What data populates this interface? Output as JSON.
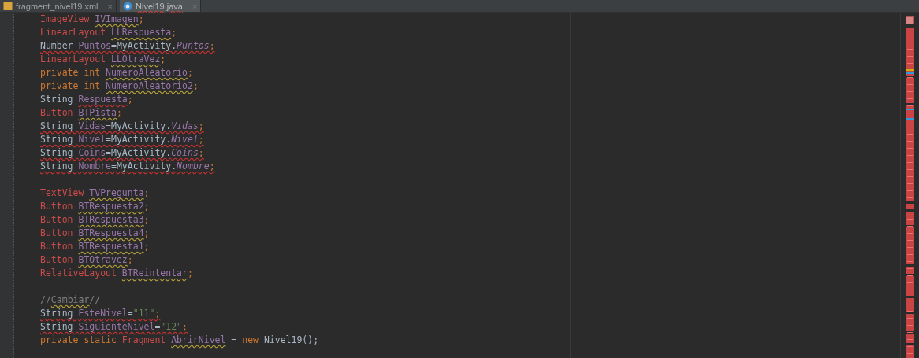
{
  "tabs": [
    {
      "label": "fragment_nivel19.xml",
      "close": "×",
      "kind": "xml",
      "selected": false
    },
    {
      "label": "Nivel19.java",
      "close": "×",
      "kind": "java",
      "selected": true
    }
  ],
  "code": [
    {
      "gap_before": false,
      "tokens": [
        {
          "text": "ImageView ",
          "kind": "type",
          "warning": false,
          "error": false
        },
        {
          "text": "IVImagen",
          "kind": "field",
          "warning": true,
          "error": false
        },
        {
          "text": ";",
          "kind": "punct",
          "warning": false,
          "error": false
        }
      ]
    },
    {
      "gap_before": false,
      "tokens": [
        {
          "text": "LinearLayout ",
          "kind": "type",
          "warning": false,
          "error": false
        },
        {
          "text": "LLRespuesta",
          "kind": "field",
          "warning": true,
          "error": false
        },
        {
          "text": ";",
          "kind": "punct",
          "warning": false,
          "error": false
        }
      ]
    },
    {
      "gap_before": false,
      "tokens": [
        {
          "text": "Number ",
          "kind": "plain",
          "warning": false,
          "error": true
        },
        {
          "text": "Puntos",
          "kind": "field",
          "warning": false,
          "error": true
        },
        {
          "text": "=MyActivity.",
          "kind": "plain",
          "warning": false,
          "error": true
        },
        {
          "text": "Puntos",
          "kind": "static",
          "warning": false,
          "error": true
        },
        {
          "text": ";",
          "kind": "punct",
          "warning": false,
          "error": true
        }
      ]
    },
    {
      "gap_before": false,
      "tokens": [
        {
          "text": "LinearLayout ",
          "kind": "type",
          "warning": false,
          "error": false
        },
        {
          "text": "LLOtraVez",
          "kind": "field",
          "warning": true,
          "error": false
        },
        {
          "text": ";",
          "kind": "punct",
          "warning": false,
          "error": false
        }
      ]
    },
    {
      "gap_before": false,
      "tokens": [
        {
          "text": "private int ",
          "kind": "keyword",
          "warning": false,
          "error": false
        },
        {
          "text": "NumeroAleatorio",
          "kind": "field",
          "warning": true,
          "error": false
        },
        {
          "text": ";",
          "kind": "punct",
          "warning": false,
          "error": false
        }
      ]
    },
    {
      "gap_before": false,
      "tokens": [
        {
          "text": "private int ",
          "kind": "keyword",
          "warning": false,
          "error": false
        },
        {
          "text": "NumeroAleatorio2",
          "kind": "field",
          "warning": true,
          "error": false
        },
        {
          "text": ";",
          "kind": "punct",
          "warning": false,
          "error": false
        }
      ]
    },
    {
      "gap_before": false,
      "tokens": [
        {
          "text": "String ",
          "kind": "plain",
          "warning": false,
          "error": false
        },
        {
          "text": "Respuesta",
          "kind": "field",
          "warning": false,
          "error": true
        },
        {
          "text": ";",
          "kind": "punct",
          "warning": false,
          "error": false
        }
      ]
    },
    {
      "gap_before": false,
      "tokens": [
        {
          "text": "Button ",
          "kind": "type",
          "warning": false,
          "error": false
        },
        {
          "text": "BTPista",
          "kind": "field",
          "warning": true,
          "error": false
        },
        {
          "text": ";",
          "kind": "punct",
          "warning": false,
          "error": false
        }
      ]
    },
    {
      "gap_before": false,
      "tokens": [
        {
          "text": "String ",
          "kind": "plain",
          "warning": false,
          "error": true
        },
        {
          "text": "Vidas",
          "kind": "field",
          "warning": false,
          "error": true
        },
        {
          "text": "=MyActivity.",
          "kind": "plain",
          "warning": false,
          "error": true
        },
        {
          "text": "Vidas",
          "kind": "static",
          "warning": false,
          "error": true
        },
        {
          "text": ";",
          "kind": "punct",
          "warning": false,
          "error": true
        }
      ]
    },
    {
      "gap_before": false,
      "tokens": [
        {
          "text": "String ",
          "kind": "plain",
          "warning": false,
          "error": true
        },
        {
          "text": "Nivel",
          "kind": "field",
          "warning": false,
          "error": true
        },
        {
          "text": "=MyActivity.",
          "kind": "plain",
          "warning": false,
          "error": true
        },
        {
          "text": "Nivel",
          "kind": "static",
          "warning": false,
          "error": true
        },
        {
          "text": ";",
          "kind": "punct",
          "warning": false,
          "error": true
        }
      ]
    },
    {
      "gap_before": false,
      "tokens": [
        {
          "text": "String ",
          "kind": "plain",
          "warning": false,
          "error": true
        },
        {
          "text": "Coins",
          "kind": "field",
          "warning": false,
          "error": true
        },
        {
          "text": "=MyActivity.",
          "kind": "plain",
          "warning": false,
          "error": true
        },
        {
          "text": "Coins",
          "kind": "static",
          "warning": false,
          "error": true
        },
        {
          "text": ";",
          "kind": "punct",
          "warning": false,
          "error": true
        }
      ]
    },
    {
      "gap_before": false,
      "tokens": [
        {
          "text": "String ",
          "kind": "plain",
          "warning": false,
          "error": true
        },
        {
          "text": "Nombre",
          "kind": "field",
          "warning": false,
          "error": true
        },
        {
          "text": "=MyActivity.",
          "kind": "plain",
          "warning": false,
          "error": true
        },
        {
          "text": "Nombre",
          "kind": "static",
          "warning": false,
          "error": true
        },
        {
          "text": ";",
          "kind": "punct",
          "warning": false,
          "error": true
        }
      ]
    },
    {
      "gap_before": true,
      "tokens": [
        {
          "text": "TextView ",
          "kind": "type",
          "warning": false,
          "error": false
        },
        {
          "text": "TVPregunta",
          "kind": "field",
          "warning": true,
          "error": false
        },
        {
          "text": ";",
          "kind": "punct",
          "warning": false,
          "error": false
        }
      ]
    },
    {
      "gap_before": false,
      "tokens": [
        {
          "text": "Button ",
          "kind": "type",
          "warning": false,
          "error": false
        },
        {
          "text": "BTRespuesta2",
          "kind": "field",
          "warning": true,
          "error": false
        },
        {
          "text": ";",
          "kind": "punct",
          "warning": false,
          "error": false
        }
      ]
    },
    {
      "gap_before": false,
      "tokens": [
        {
          "text": "Button ",
          "kind": "type",
          "warning": false,
          "error": false
        },
        {
          "text": "BTRespuesta3",
          "kind": "field",
          "warning": true,
          "error": false
        },
        {
          "text": ";",
          "kind": "punct",
          "warning": false,
          "error": false
        }
      ]
    },
    {
      "gap_before": false,
      "tokens": [
        {
          "text": "Button ",
          "kind": "type",
          "warning": false,
          "error": false
        },
        {
          "text": "BTRespuesta4",
          "kind": "field",
          "warning": true,
          "error": false
        },
        {
          "text": ";",
          "kind": "punct",
          "warning": false,
          "error": false
        }
      ]
    },
    {
      "gap_before": false,
      "tokens": [
        {
          "text": "Button ",
          "kind": "type",
          "warning": false,
          "error": false
        },
        {
          "text": "BTRespuesta1",
          "kind": "field",
          "warning": true,
          "error": false
        },
        {
          "text": ";",
          "kind": "punct",
          "warning": false,
          "error": false
        }
      ]
    },
    {
      "gap_before": false,
      "tokens": [
        {
          "text": "Button ",
          "kind": "type",
          "warning": false,
          "error": false
        },
        {
          "text": "BTOtravez",
          "kind": "field",
          "warning": true,
          "error": false
        },
        {
          "text": ";",
          "kind": "punct",
          "warning": false,
          "error": false
        }
      ]
    },
    {
      "gap_before": false,
      "tokens": [
        {
          "text": "RelativeLayout ",
          "kind": "type",
          "warning": false,
          "error": false
        },
        {
          "text": "BTReintentar",
          "kind": "field",
          "warning": true,
          "error": false
        },
        {
          "text": ";",
          "kind": "punct",
          "warning": false,
          "error": false
        }
      ]
    },
    {
      "gap_before": true,
      "tokens": [
        {
          "text": "//",
          "kind": "comment",
          "warning": false,
          "error": false
        },
        {
          "text": "Cambiar",
          "kind": "comment",
          "warning": true,
          "error": false
        },
        {
          "text": "//",
          "kind": "comment",
          "warning": false,
          "error": false
        }
      ]
    },
    {
      "gap_before": false,
      "tokens": [
        {
          "text": "String ",
          "kind": "plain",
          "warning": false,
          "error": true
        },
        {
          "text": "EsteNivel",
          "kind": "field",
          "warning": false,
          "error": true
        },
        {
          "text": "=",
          "kind": "plain",
          "warning": false,
          "error": true
        },
        {
          "text": "\"11\"",
          "kind": "string",
          "warning": false,
          "error": true
        },
        {
          "text": ";",
          "kind": "punct",
          "warning": false,
          "error": true
        }
      ]
    },
    {
      "gap_before": false,
      "tokens": [
        {
          "text": "String ",
          "kind": "plain",
          "warning": false,
          "error": true
        },
        {
          "text": "SiguienteNivel",
          "kind": "field",
          "warning": false,
          "error": true
        },
        {
          "text": "=",
          "kind": "plain",
          "warning": false,
          "error": true
        },
        {
          "text": "\"12\"",
          "kind": "string",
          "warning": false,
          "error": true
        },
        {
          "text": ";",
          "kind": "punct",
          "warning": false,
          "error": true
        }
      ]
    },
    {
      "gap_before": false,
      "tokens": [
        {
          "text": "private static ",
          "kind": "keyword",
          "warning": false,
          "error": false
        },
        {
          "text": "Fragment ",
          "kind": "type",
          "warning": false,
          "error": false
        },
        {
          "text": "AbrirNivel",
          "kind": "field",
          "warning": true,
          "error": false
        },
        {
          "text": " = ",
          "kind": "plain",
          "warning": false,
          "error": false
        },
        {
          "text": "new",
          "kind": "keyword",
          "warning": false,
          "error": false
        },
        {
          "text": " Nivel19();",
          "kind": "plain",
          "warning": false,
          "error": false
        }
      ]
    }
  ]
}
